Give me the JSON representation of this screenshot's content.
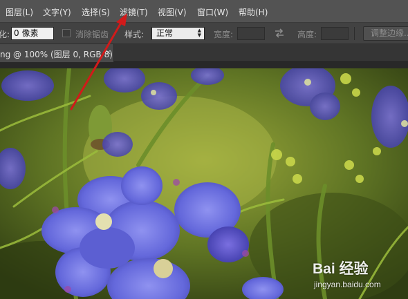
{
  "menubar": {
    "items": [
      "图层(L)",
      "文字(Y)",
      "选择(S)",
      "滤镜(T)",
      "视图(V)",
      "窗口(W)",
      "帮助(H)"
    ]
  },
  "options": {
    "feather_label_partial": "化:",
    "feather_value": "0 像素",
    "antialias_label": "消除锯齿",
    "style_label": "样式:",
    "style_value": "正常",
    "width_label": "宽度:",
    "height_label": "高度:",
    "refine_edge_label": "调整边缘..."
  },
  "document_tab": {
    "title": "ng @ 100% (图层 0, RGB/8)",
    "close_glyph": "×"
  },
  "watermark": {
    "brand": "Bai 经验",
    "url": "jingyan.baidu.com"
  },
  "colors": {
    "menubar_bg": "#535353",
    "optbar_bg": "#424242",
    "annotation_arrow": "#d11a1a"
  },
  "icons": [
    "checkbox-icon",
    "swap-arrows-icon",
    "select-arrows-icon",
    "close-icon",
    "red-annotation-arrow"
  ]
}
